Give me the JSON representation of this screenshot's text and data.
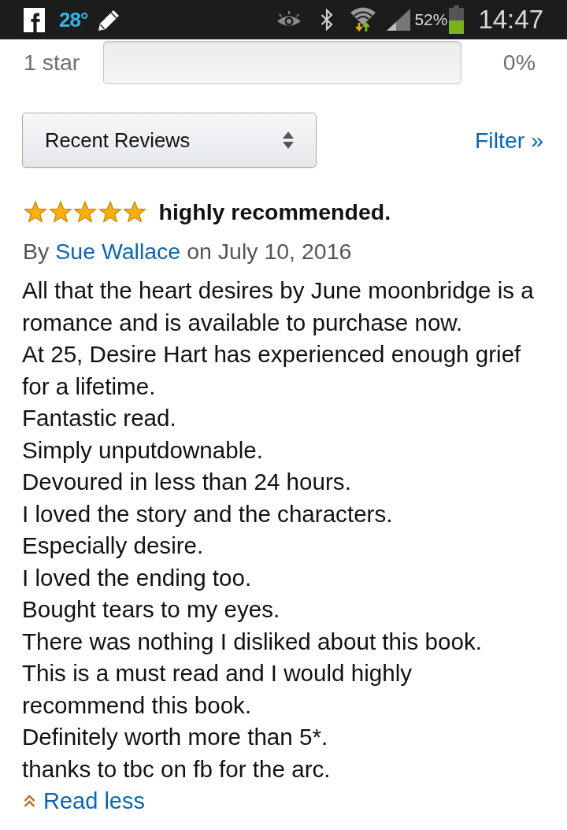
{
  "status_bar": {
    "temperature": "28°",
    "battery_percent": "52%",
    "time": "14:47"
  },
  "rating_row": {
    "label": "1 star",
    "level": 0,
    "percent": "0%"
  },
  "sort": {
    "value": "Recent Reviews"
  },
  "filter": {
    "label": "Filter »"
  },
  "review": {
    "stars": 5,
    "title": "highly recommended.",
    "by": "By",
    "author": "Sue Wallace",
    "date": "on July 10, 2016",
    "paragraphs": [
      "All that the heart desires by June moonbridge is a romance and is available to purchase now.",
      "At 25, Desire Hart has experienced enough grief for a lifetime.",
      "Fantastic read.",
      "Simply unputdownable.",
      "Devoured in less than 24 hours.",
      "I loved the story and the characters.",
      "Especially desire.",
      "I loved the ending too.",
      "Bought tears to my eyes.",
      "There was nothing I disliked about this book.",
      "This is a must read and I would highly recommend this book.",
      "Definitely worth more than 5*.",
      "thanks to tbc on fb for the arc."
    ],
    "toggle": "Read less"
  }
}
